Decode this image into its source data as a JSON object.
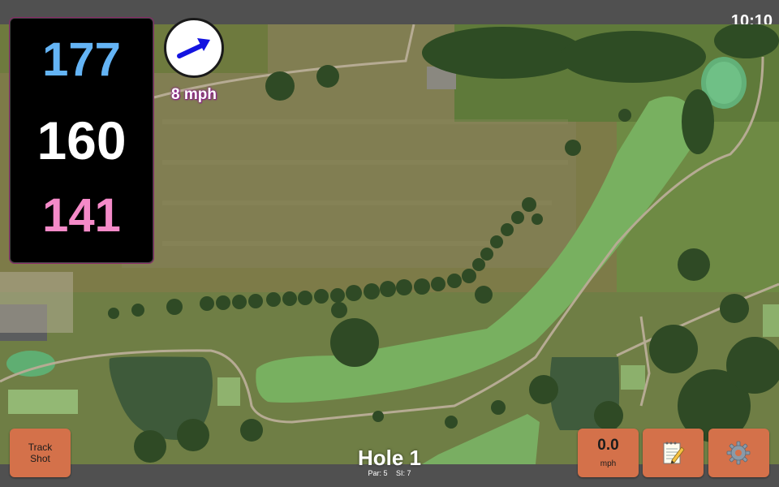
{
  "status_bar": {
    "time": "10:10"
  },
  "distances": {
    "back": "177",
    "center": "160",
    "front": "141"
  },
  "wind": {
    "speed": "8 mph",
    "direction_icon": "arrow-icon"
  },
  "hole": {
    "title": "Hole 1",
    "par": "Par: 5",
    "stroke_index": "SI: 7"
  },
  "buttons": {
    "track_shot_line1": "Track",
    "track_shot_line2": "Shot",
    "speed_value": "0.0",
    "speed_unit": "mph",
    "notes_icon": "notepad-icon",
    "settings_icon": "gear-icon"
  },
  "colors": {
    "back_distance": "#64b4f5",
    "center_distance": "#ffffff",
    "front_distance": "#f48ac8",
    "button": "#d4714a",
    "bar": "#505050"
  }
}
